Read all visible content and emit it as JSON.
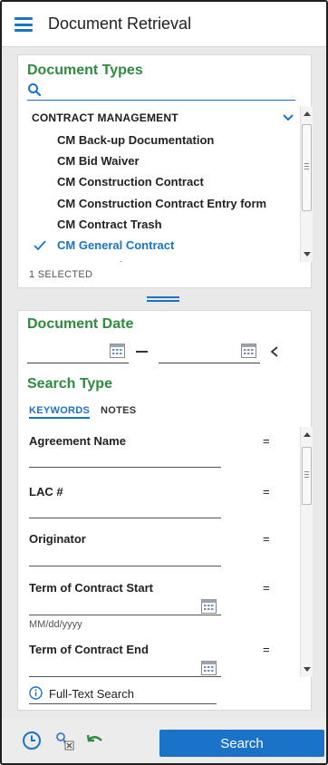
{
  "header": {
    "title": "Document Retrieval",
    "menu_icon": "hamburger-icon"
  },
  "document_types": {
    "title": "Document Types",
    "search_placeholder": "",
    "group": "CONTRACT MANAGEMENT",
    "items": [
      {
        "label": "CM Back-up Documentation",
        "selected": false
      },
      {
        "label": "CM Bid Waiver",
        "selected": false
      },
      {
        "label": "CM Construction Contract",
        "selected": false
      },
      {
        "label": "CM Construction Contract Entry form",
        "selected": false
      },
      {
        "label": "CM Contract Trash",
        "selected": false
      },
      {
        "label": "CM General Contract",
        "selected": true
      },
      {
        "label": "CM General Contract Entry Form",
        "selected": false
      }
    ],
    "selected_count": "1 SELECTED"
  },
  "document_date": {
    "title": "Document Date",
    "from_value": "",
    "to_value": ""
  },
  "search_type": {
    "title": "Search Type",
    "tabs": [
      {
        "label": "KEYWORDS",
        "active": true
      },
      {
        "label": "NOTES",
        "active": false
      }
    ],
    "keywords": [
      {
        "label": "Agreement Name",
        "operator": "=",
        "hint": "",
        "has_calendar": false
      },
      {
        "label": "LAC #",
        "operator": "=",
        "hint": "",
        "has_calendar": false
      },
      {
        "label": "Originator",
        "operator": "=",
        "hint": "",
        "has_calendar": false
      },
      {
        "label": "Term of Contract Start",
        "operator": "=",
        "hint": "MM/dd/yyyy",
        "has_calendar": true
      },
      {
        "label": "Term of Contract End",
        "operator": "=",
        "hint": "",
        "has_calendar": true
      }
    ],
    "fulltext_label": "Full-Text Search"
  },
  "footer": {
    "search_label": "Search"
  },
  "colors": {
    "accent": "#1a73c8",
    "section_title": "#2e8b3e"
  }
}
